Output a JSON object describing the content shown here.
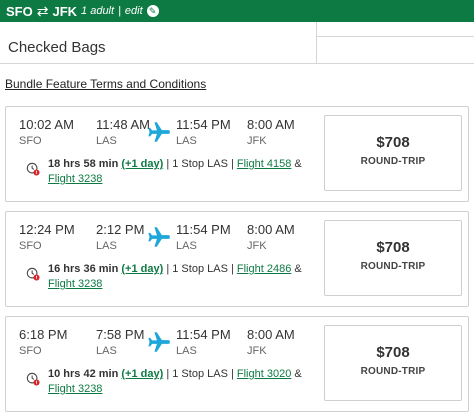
{
  "header": {
    "origin": "SFO",
    "swap_icon": "swap-arrows-icon",
    "destination": "JFK",
    "passengers": "1 adult",
    "separator": "|",
    "edit_label": "edit",
    "brand_color": "#0e7a43"
  },
  "bags": {
    "label": "Checked Bags"
  },
  "terms": {
    "label": "Bundle Feature Terms and Conditions"
  },
  "flights": [
    {
      "dep_time": "10:02 AM",
      "dep_airport": "SFO",
      "conn_arr_time": "11:48 AM",
      "conn_airport": "LAS",
      "conn_dep_time": "11:54 PM",
      "conn_dep_airport": "LAS",
      "arr_time": "8:00 AM",
      "arr_airport": "JFK",
      "duration": "18 hrs 58 min",
      "plus_day": "(+1 day)",
      "stops": "| 1 Stop LAS |",
      "flight1": "Flight 4158",
      "amp": "&",
      "flight2": "Flight 3238",
      "price": "$708",
      "fare_type": "ROUND-TRIP"
    },
    {
      "dep_time": "12:24 PM",
      "dep_airport": "SFO",
      "conn_arr_time": "2:12 PM",
      "conn_airport": "LAS",
      "conn_dep_time": "11:54 PM",
      "conn_dep_airport": "LAS",
      "arr_time": "8:00 AM",
      "arr_airport": "JFK",
      "duration": "16 hrs 36 min",
      "plus_day": "(+1 day)",
      "stops": "| 1 Stop LAS |",
      "flight1": "Flight 2486",
      "amp": "&",
      "flight2": "Flight 3238",
      "price": "$708",
      "fare_type": "ROUND-TRIP"
    },
    {
      "dep_time": "6:18 PM",
      "dep_airport": "SFO",
      "conn_arr_time": "7:58 PM",
      "conn_airport": "LAS",
      "conn_dep_time": "11:54 PM",
      "conn_dep_airport": "LAS",
      "arr_time": "8:00 AM",
      "arr_airport": "JFK",
      "duration": "10 hrs 42 min",
      "plus_day": "(+1 day)",
      "stops": "| 1 Stop LAS |",
      "flight1": "Flight 3020",
      "amp": "&",
      "flight2": "Flight 3238",
      "price": "$708",
      "fare_type": "ROUND-TRIP"
    }
  ],
  "icons": {
    "plane": "airplane-icon",
    "clock": "clock-alert-icon"
  },
  "colors": {
    "plane": "#1ea7d9",
    "alert": "#d9262b",
    "link": "#0e7a43"
  }
}
